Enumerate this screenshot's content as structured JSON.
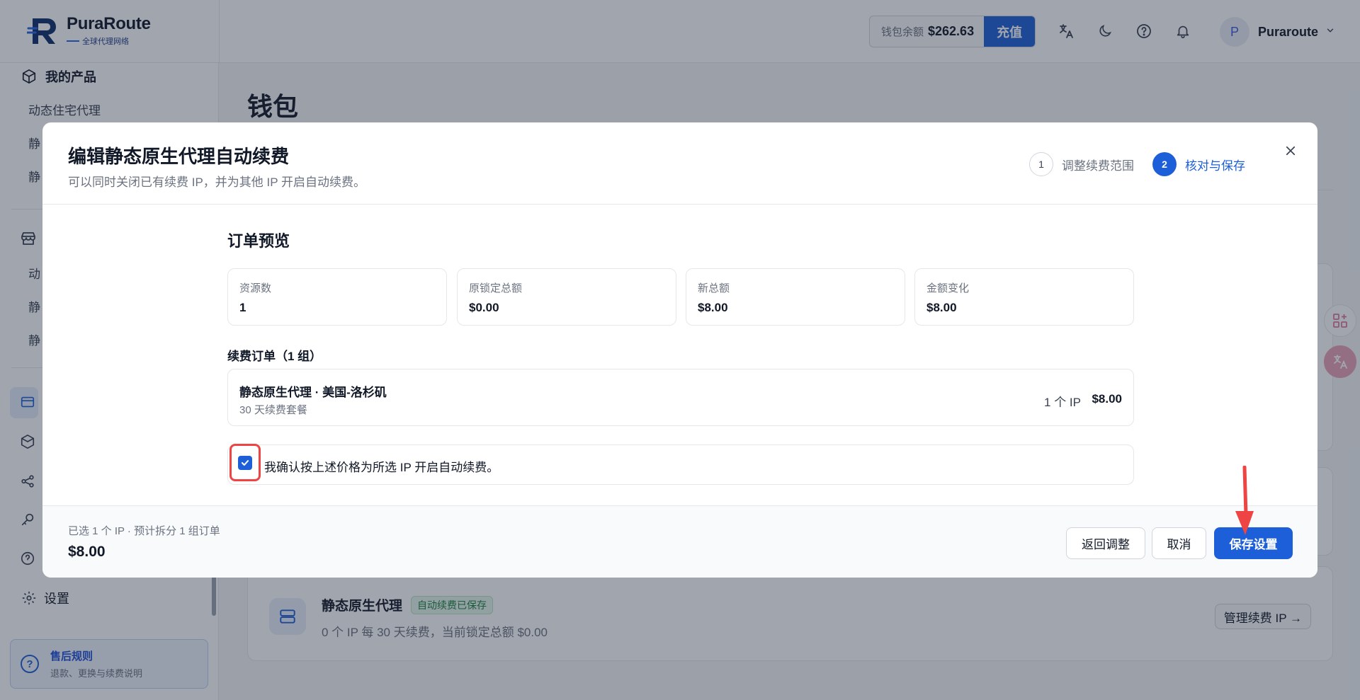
{
  "brand": {
    "name": "PuraRoute",
    "tagline": "全球代理网络"
  },
  "header": {
    "wallet_label": "钱包余额",
    "wallet_amount": "$262.63",
    "topup_label": "充值",
    "user_initial": "P",
    "user_name": "Puraroute",
    "icons": [
      "translate-icon",
      "moon-icon",
      "help-icon",
      "bell-icon",
      "chevron-down-icon"
    ]
  },
  "sidebar": {
    "products_title": "我的产品",
    "product_items": [
      "动态住宅代理",
      "静",
      "静"
    ],
    "store_items": [
      "动",
      "静",
      "静"
    ],
    "settings_label": "设置",
    "aftersale": {
      "title": "售后规则",
      "subtitle": "退款、更换与续费说明"
    }
  },
  "page": {
    "title": "钱包",
    "card": {
      "name": "静态原生代理",
      "badge": "自动续费已保存",
      "subtitle": "0 个 IP 每 30 天续费，当前锁定总额 $0.00",
      "manage_label": "管理续费 IP →"
    }
  },
  "modal": {
    "title": "编辑静态原生代理自动续费",
    "subtitle": "可以同时关闭已有续费 IP，并为其他 IP 开启自动续费。",
    "steps": [
      {
        "num": "1",
        "label": "调整续费范围",
        "state": "done"
      },
      {
        "num": "2",
        "label": "核对与保存",
        "state": "active"
      }
    ],
    "preview_title": "订单预览",
    "stats": [
      {
        "label": "资源数",
        "value": "1"
      },
      {
        "label": "原锁定总额",
        "value": "$0.00"
      },
      {
        "label": "新总额",
        "value": "$8.00"
      },
      {
        "label": "金额变化",
        "value": "$8.00"
      }
    ],
    "orders_title": "续费订单（1 组）",
    "orders": [
      {
        "name": "静态原生代理 · 美国-洛杉矶",
        "plan": "30 天续费套餐",
        "count": "1 个 IP",
        "price": "$8.00"
      }
    ],
    "confirm_text": "我确认按上述价格为所选 IP 开启自动续费。",
    "confirm_checked": true,
    "footer": {
      "summary": "已选 1 个 IP · 预计拆分 1 组订单",
      "total": "$8.00",
      "back_label": "返回调整",
      "cancel_label": "取消",
      "save_label": "保存设置"
    }
  },
  "colors": {
    "primary": "#1d5fd8",
    "highlight": "#ef4444",
    "badge_green": "#15803d"
  }
}
